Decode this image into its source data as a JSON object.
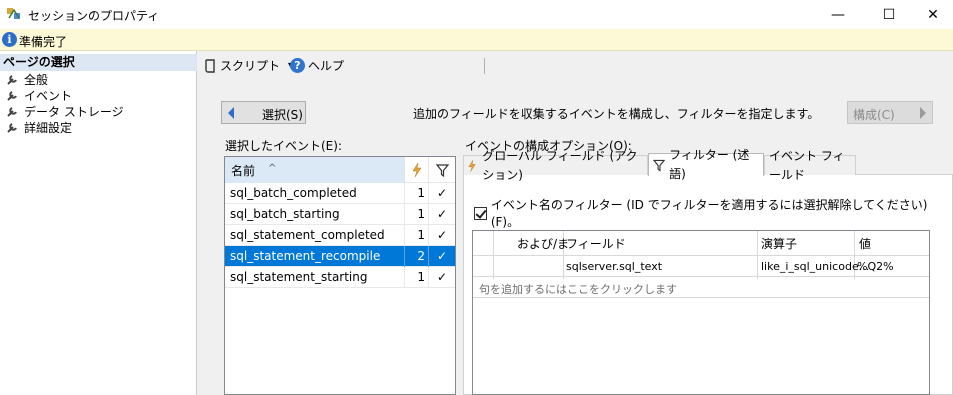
{
  "window": {
    "title": "セッションのプロパティ",
    "minimize_glyph": "—",
    "maximize_glyph": "☐",
    "close_glyph": "✕"
  },
  "status": {
    "icon": "info-icon",
    "icon_glyph": "i",
    "text": "準備完了"
  },
  "left_pane": {
    "header": "ページの選択",
    "items": [
      {
        "label": "全般",
        "icon": "wrench-icon"
      },
      {
        "label": "イベント",
        "icon": "wrench-icon"
      },
      {
        "label": "データ ストレージ",
        "icon": "wrench-icon"
      },
      {
        "label": "詳細設定",
        "icon": "wrench-icon"
      }
    ]
  },
  "toolbar": {
    "script_label": "スクリプト",
    "script_icon": "script-icon",
    "dropdown_glyph": "▾",
    "help_label": "ヘルプ",
    "help_icon": "help-icon",
    "help_glyph": "?"
  },
  "main": {
    "select_button": "選択(S)",
    "instruction": "追加のフィールドを収集するイベントを構成し、フィルターを指定します。",
    "configure_button": "構成(C)",
    "selected_events_label": "選択したイベント(E):",
    "config_options_label": "イベントの構成オプション(O):"
  },
  "events_grid": {
    "col_name": "名前",
    "sort_glyph": "^",
    "rows": [
      {
        "name": "sql_batch_completed",
        "count": "1",
        "check": "✓",
        "selected": false
      },
      {
        "name": "sql_batch_starting",
        "count": "1",
        "check": "✓",
        "selected": false
      },
      {
        "name": "sql_statement_completed",
        "count": "1",
        "check": "✓",
        "selected": false
      },
      {
        "name": "sql_statement_recompile",
        "count": "2",
        "check": "✓",
        "selected": true
      },
      {
        "name": "sql_statement_starting",
        "count": "1",
        "check": "✓",
        "selected": false
      }
    ]
  },
  "tabs": [
    {
      "label": "グローバル フィールド (アクション)",
      "icon": "lightning-icon",
      "active": false
    },
    {
      "label": "フィルター (述語)",
      "icon": "filter-icon",
      "active": true
    },
    {
      "label": "イベント フィールド",
      "icon": "",
      "active": false
    }
  ],
  "filter_panel": {
    "checkbox_label": "イベント名のフィルター (ID でフィルターを適用するには選択解除してください) (F)。",
    "checked": true,
    "grid": {
      "col_andor": "および/ま",
      "col_field": "フィールド",
      "col_operator": "演算子",
      "col_value": "値",
      "rows": [
        {
          "field": "sqlserver.sql_text",
          "operator": "like_i_sql_unicode...",
          "value": "%Q2%"
        }
      ],
      "add_row_text": "句を追加するにはここをクリックします"
    }
  },
  "colors": {
    "status_bg": "#fdf9d7",
    "selection": "#0078d7",
    "header_bg": "#dbe8f6"
  }
}
